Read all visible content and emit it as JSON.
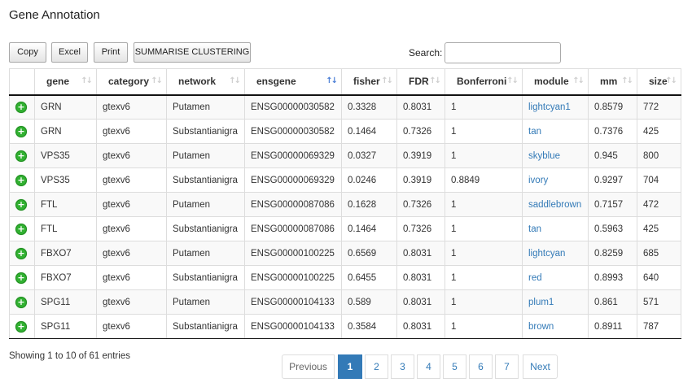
{
  "page": {
    "title": "Gene Annotation"
  },
  "toolbar": {
    "copy_label": "Copy",
    "excel_label": "Excel",
    "print_label": "Print",
    "summarise_label": "SUMMARISE CLUSTERING"
  },
  "search": {
    "label": "Search:",
    "value": "",
    "placeholder": ""
  },
  "table": {
    "columns": [
      "gene",
      "category",
      "network",
      "ensgene",
      "fisher",
      "FDR",
      "Bonferroni",
      "module",
      "mm",
      "size"
    ],
    "sort": {
      "column": "ensgene",
      "direction": "ascending"
    },
    "rows": [
      [
        "GRN",
        "gtexv6",
        "Putamen",
        "ENSG00000030582",
        "0.3328",
        "0.8031",
        "1",
        "lightcyan1",
        "0.8579",
        "772"
      ],
      [
        "GRN",
        "gtexv6",
        "Substantianigra",
        "ENSG00000030582",
        "0.1464",
        "0.7326",
        "1",
        "tan",
        "0.7376",
        "425"
      ],
      [
        "VPS35",
        "gtexv6",
        "Putamen",
        "ENSG00000069329",
        "0.0327",
        "0.3919",
        "1",
        "skyblue",
        "0.945",
        "800"
      ],
      [
        "VPS35",
        "gtexv6",
        "Substantianigra",
        "ENSG00000069329",
        "0.0246",
        "0.3919",
        "0.8849",
        "ivory",
        "0.9297",
        "704"
      ],
      [
        "FTL",
        "gtexv6",
        "Putamen",
        "ENSG00000087086",
        "0.1628",
        "0.7326",
        "1",
        "saddlebrown",
        "0.7157",
        "472"
      ],
      [
        "FTL",
        "gtexv6",
        "Substantianigra",
        "ENSG00000087086",
        "0.1464",
        "0.7326",
        "1",
        "tan",
        "0.5963",
        "425"
      ],
      [
        "FBXO7",
        "gtexv6",
        "Putamen",
        "ENSG00000100225",
        "0.6569",
        "0.8031",
        "1",
        "lightcyan",
        "0.8259",
        "685"
      ],
      [
        "FBXO7",
        "gtexv6",
        "Substantianigra",
        "ENSG00000100225",
        "0.6455",
        "0.8031",
        "1",
        "red",
        "0.8993",
        "640"
      ],
      [
        "SPG11",
        "gtexv6",
        "Putamen",
        "ENSG00000104133",
        "0.589",
        "0.8031",
        "1",
        "plum1",
        "0.861",
        "571"
      ],
      [
        "SPG11",
        "gtexv6",
        "Substantianigra",
        "ENSG00000104133",
        "0.3584",
        "0.8031",
        "1",
        "brown",
        "0.8911",
        "787"
      ]
    ]
  },
  "footer": {
    "info": "Showing 1 to 10 of 61 entries"
  },
  "pagination": {
    "previous_label": "Previous",
    "next_label": "Next",
    "pages": [
      "1",
      "2",
      "3",
      "4",
      "5",
      "6",
      "7"
    ],
    "current_page": "1"
  },
  "colors": {
    "accent": "#337ab7",
    "expand_icon": "#31b131",
    "sort_active": "#4a7ed6"
  }
}
